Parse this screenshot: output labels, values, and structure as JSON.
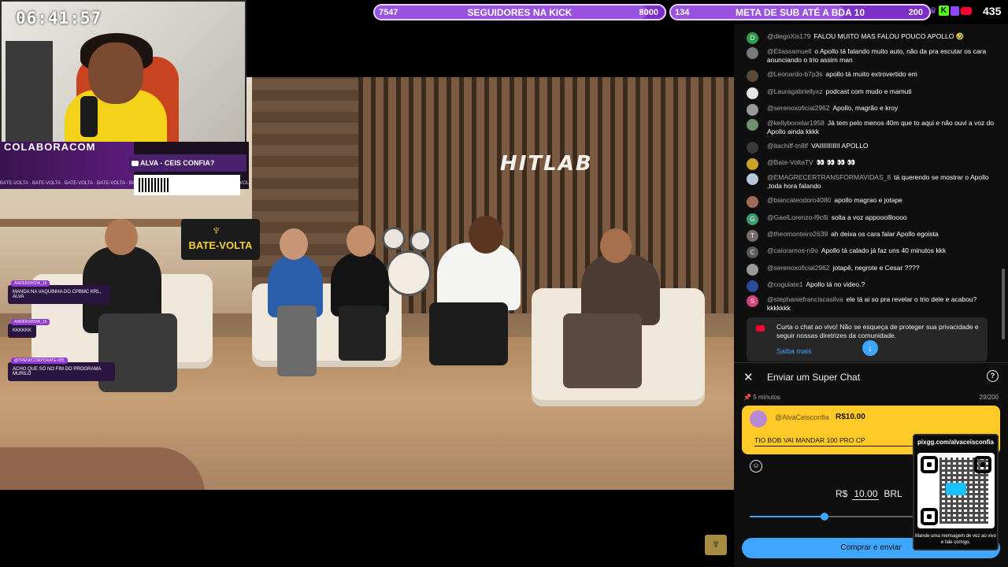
{
  "clock": "06:41:57",
  "top_goals": [
    {
      "left": "7547",
      "label": "SEGUIDORES NA KICK",
      "right": "8000",
      "progress": 0.94
    },
    {
      "left": "134",
      "label": "META DE SUB ATÉ A BDA 10",
      "right": "200",
      "progress": 0.67
    }
  ],
  "viewer_count": "435",
  "studio_logo": "HITLAB",
  "bate_volta_sign": "BATE-VOLTA",
  "webcam_overlay": {
    "handle": "COLABORACOM",
    "yt_label": "ALVA - CEIS CONFIA?",
    "ticker": "BATE-VOLTA · BATE-VOLTA · BATE-VOLTA · BATE-VOLTA · BATE-VOLTA · BATE-VOLTA · BATE-VOLTA · BATE-VOLTA"
  },
  "stream_chat": [
    {
      "tag": "ANDERSHOW_16",
      "text": "MANDA NA VAQUINHA DO CPBMC KRL, ALVA"
    },
    {
      "tag": "ANDERSHOW_16",
      "text": "KKKKKK"
    },
    {
      "tag": "@TRENDCORPORATE-085",
      "text": "ACHO QUE SÓ NO FIM DO PROGRAMA MURILO"
    }
  ],
  "chat": {
    "messages": [
      {
        "user": "@diegoXis179",
        "text": "FALOU MUITO MAS FALOU POUCO APOLLO 🤣",
        "avatar_color": "#2e9d4b",
        "avatar_letter": "D"
      },
      {
        "user": "@Eliassamuell",
        "text": "o Apollo tá falando muito auto, não da pra escutar os cara anunciando o trio assim man",
        "avatar_color": "#7a7a7a",
        "avatar_letter": ""
      },
      {
        "user": "@Leonardo-b7p3s",
        "text": "apollo tá muito extrovertido em",
        "avatar_color": "#5a4a3a",
        "avatar_letter": ""
      },
      {
        "user": "@Lauragabriellyxz",
        "text": "podcast com mudo e mamuti",
        "avatar_color": "#e4e4e4",
        "avatar_letter": ""
      },
      {
        "user": "@serenoxoficial2962",
        "text": "Apollo, magrão e kroy",
        "avatar_color": "#9a9a9a",
        "avatar_letter": ""
      },
      {
        "user": "@kellybonelar1958",
        "text": "Já tem pelo menos 40m que to aqui e não ouvi a voz do Apollo ainda kkkk",
        "avatar_color": "#6d8f6a",
        "avatar_letter": ""
      },
      {
        "user": "@itachiff-tn8lf",
        "text": "VAIIIIIIIIIII APOLLO",
        "avatar_color": "#3a3a3a",
        "avatar_letter": ""
      },
      {
        "user": "@Bate-VoltaTV",
        "text": "👀 👀 👀 👀",
        "avatar_color": "#c9a227",
        "avatar_letter": ""
      },
      {
        "user": "@EMAGRECERTRANSFORMAVIDAS_8",
        "text": "tá querendo se mostrar o Apollo ,toda hora falando",
        "avatar_color": "#b5c7d9",
        "avatar_letter": ""
      },
      {
        "user": "@biancateodoro4080",
        "text": "apollo magrao e jotape",
        "avatar_color": "#a06a5a",
        "avatar_letter": ""
      },
      {
        "user": "@GaelLorenzo-l9c6i",
        "text": "solta a voz appooollloooo",
        "avatar_color": "#3b9c6e",
        "avatar_letter": "G"
      },
      {
        "user": "@theomonteiro2639",
        "text": "ah deixa os cara falar Apollo egoista",
        "avatar_color": "#7a6a6a",
        "avatar_letter": "T"
      },
      {
        "user": "@caioramos-n9o",
        "text": "Apollo tá calado já faz uns 40 minutos kkk",
        "avatar_color": "#5a5a5a",
        "avatar_letter": "C"
      },
      {
        "user": "@serenoxoficial2962",
        "text": "jotapê, negrote e Cesar ????",
        "avatar_color": "#9a9a9a",
        "avatar_letter": ""
      },
      {
        "user": "@cogulate1",
        "text": "Apollo tá no video.?",
        "avatar_color": "#2b4a9c",
        "avatar_letter": ""
      },
      {
        "user": "@stephaniefranciscasilva",
        "text": "ele tá ai so pra revelar o trio dele e acabou? kkkkkkk",
        "avatar_color": "#d4427a",
        "avatar_letter": "S"
      }
    ],
    "notice": "Curta o chat ao vivo! Não se esqueça de proteger sua privacidade e seguir nossas diretrizes da comunidade.",
    "notice_link": "Saiba mais"
  },
  "superchat": {
    "title": "Enviar um Super Chat",
    "pin_duration": "5 minutos",
    "char_count": "29/200",
    "user": "@AlvaCeisconfia",
    "amount": "R$10.00",
    "message": "TIO BOB VAI MANDAR 100 PRO CP",
    "currency_symbol": "R$",
    "value": "10.00",
    "currency_code": "BRL",
    "slider_fraction": 0.43,
    "buy_label": "Comprar e enviar"
  },
  "qr_overlay": {
    "url": "pixgg.com/alvaceisconfia",
    "caption": "Mande uma mensagem de voz ao vivo e fale comigo."
  }
}
